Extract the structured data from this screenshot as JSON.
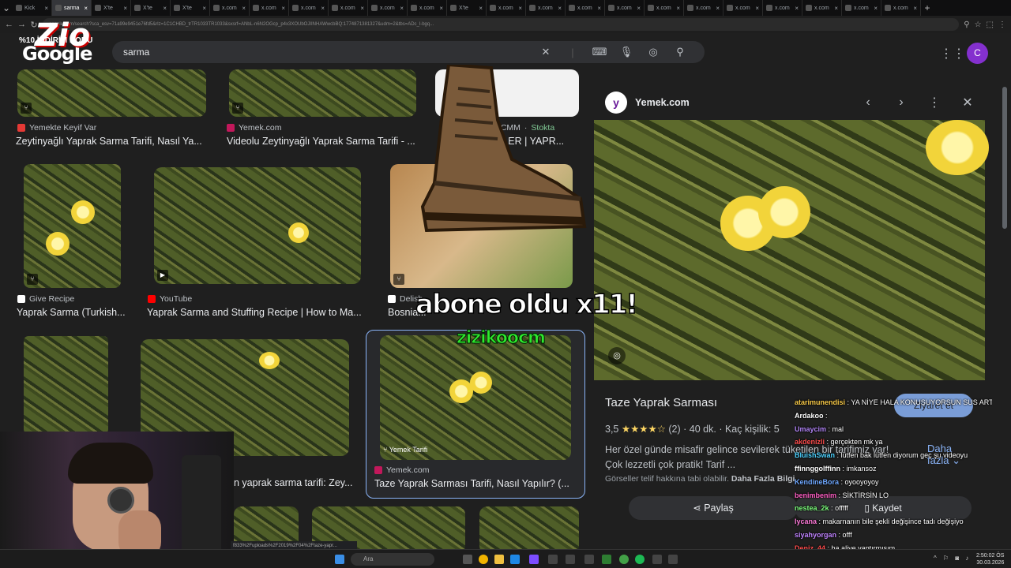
{
  "browser": {
    "tabs": [
      {
        "label": "Kick"
      },
      {
        "label": "sarma"
      },
      {
        "label": "X'te"
      },
      {
        "label": "X'te"
      },
      {
        "label": "X'te"
      },
      {
        "label": "x.com"
      },
      {
        "label": "x.com"
      },
      {
        "label": "x.com"
      },
      {
        "label": "x.com"
      },
      {
        "label": "x.com"
      },
      {
        "label": "x.com"
      },
      {
        "label": "X'te"
      },
      {
        "label": "x.com"
      },
      {
        "label": "x.com"
      },
      {
        "label": "x.com"
      },
      {
        "label": "x.com"
      },
      {
        "label": "x.com"
      },
      {
        "label": "x.com"
      },
      {
        "label": "x.com"
      },
      {
        "label": "x.com"
      },
      {
        "label": "x.com"
      },
      {
        "label": "x.com"
      },
      {
        "label": "x.com"
      }
    ],
    "url": "google.com/search?sca_esv=71a99e9451e76fd5&rlz=1C1CHBD_trTR1033TR1033&sxsrf=ANbL-n6N2OGcp_p4x3XOUbOJIINHAWwcbBQ:1774871381327&udm=2&tbs=ADc_l-bgq..."
  },
  "google": {
    "logo": "Google",
    "query": "sarma",
    "profile_initial": "C"
  },
  "stream_overlay": {
    "brand": "Zio",
    "promo": "%10 İNDİRİM KODU",
    "alert_text": "abone oldu x11!",
    "alert_user": "zizikoocm"
  },
  "results": [
    {
      "source": "Yemekte Keyif Var",
      "title": "Zeytinyağlı Yaprak Sarma Tarifi, Nasıl Ya..."
    },
    {
      "source": "Yemek.com",
      "title": "Videolu Zeytinyağlı Yaprak Sarma Tarifi - ..."
    },
    {
      "source": "irCMM",
      "stock": "Stokta",
      "title": "ELER | YAPR..."
    },
    {
      "source": "Give Recipe",
      "title": "Yaprak Sarma (Turkish..."
    },
    {
      "source": "YouTube",
      "title": "Yaprak Sarma and Stuffing Recipe | How to Ma..."
    },
    {
      "source": "Delish",
      "title": "Bosnia..."
    },
    {
      "source": "Yemek.com",
      "badge": "Yemek Tarifi",
      "title": "Taze Yaprak Sarması Tarifi, Nasıl Yapılır? (..."
    },
    {
      "title": "n yaprak sarma tarifi: Zey..."
    }
  ],
  "preview": {
    "site": "Yemek.com",
    "title": "Taze Yaprak Sarması",
    "rating": "3,5",
    "stars": "★★★★☆",
    "reviews": "(2)",
    "duration": "40 dk.",
    "servings": "Kaç kişilik: 5",
    "description": "Her özel günde misafir gelince sevilerek tüketilen bir tarifimiz var! Çok lezzetli çok pratik! Tarif ...",
    "more": "Daha fazla",
    "copyright": "Görseller telif hakkına tabi olabilir.",
    "copyright_link": "Daha Fazla Bilgi",
    "share": "Paylaş",
    "visit": "Ziyaret et",
    "save": "Kaydet"
  },
  "chat": [
    {
      "user": "atarimunendisi",
      "text": "YA NİYE HALA KONUŞUYORSUN SUS ARTIK SUS",
      "color": "#f7c948"
    },
    {
      "user": "Ardakoo",
      "text": "",
      "color": "#ffffff"
    },
    {
      "user": "Umaycim",
      "text": "mal",
      "color": "#b084f5"
    },
    {
      "user": "akdenizli",
      "text": "gerçekten mk ya",
      "color": "#ff4d4d"
    },
    {
      "user": "BluishSwan",
      "text": "lütfen bak lütfen diyorum geç şu videoyu",
      "color": "#4dd2ff"
    },
    {
      "user": "ffinnggolffinn",
      "text": "imkansoz",
      "color": "#ffffff"
    },
    {
      "user": "KendineBora",
      "text": "oyooyoyoy",
      "color": "#6fa8ff"
    },
    {
      "user": "benimbenim",
      "text": "SİKTİRSİN LO",
      "color": "#ff5ec4"
    },
    {
      "user": "nestea_2k",
      "text": "offfff",
      "color": "#7cfc7c"
    },
    {
      "user": "lycana",
      "text": "makarnanın bile şekli değişince tadı değişiyo",
      "color": "#ff7ad9"
    },
    {
      "user": "siyahyorgan",
      "text": "offf",
      "color": "#c084ff"
    },
    {
      "user": "Deniz_44",
      "text": "ha aliye yaptırmışım",
      "color": "#ff4d4d"
    }
  ],
  "status_url": "f833%2Fuploads%2F2019%2F04%2Ftaze-yapr...",
  "taskbar": {
    "search": "Ara",
    "time": "2:50:02 ÖS",
    "date": "30.03.2026"
  }
}
